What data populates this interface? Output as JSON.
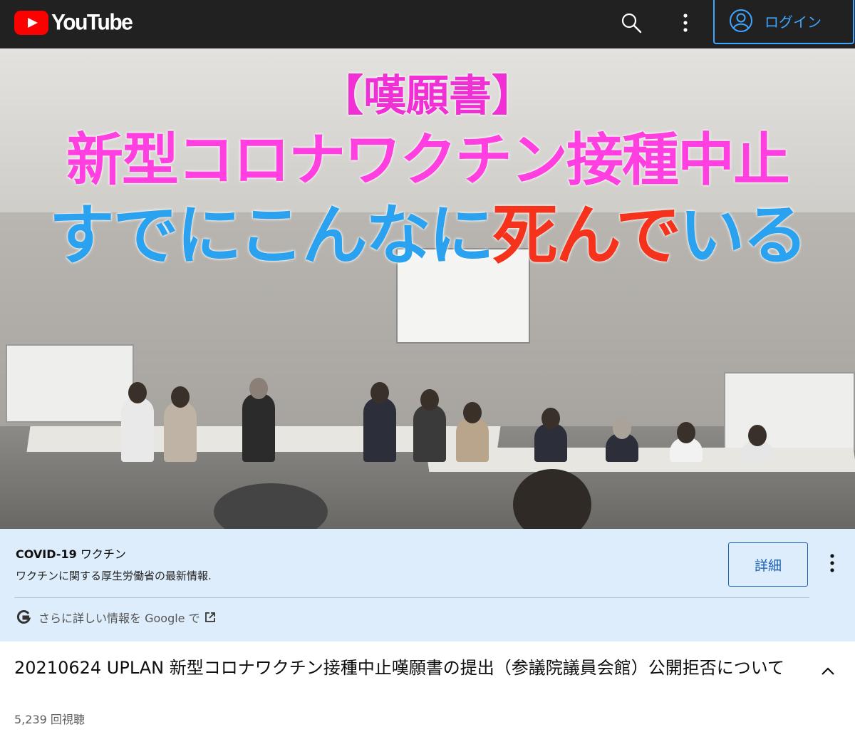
{
  "header": {
    "logo_text": "YouTube",
    "login_label": "ログイン",
    "icons": {
      "search": "search-icon",
      "menu": "more-vert-icon",
      "account": "account-circle-icon"
    },
    "colors": {
      "bar": "#212121",
      "brand": "#ff0000",
      "accent": "#3ea6ff"
    }
  },
  "video": {
    "thumbnail_text": {
      "line1": "【嘆願書】",
      "line2": "新型コロナワクチン接種中止",
      "line3_part1": "すでにこんなに",
      "line3_part2": "死んで",
      "line3_part3": "いる"
    },
    "colors": {
      "magenta": "#ff3fe0",
      "blue": "#2aa2f0",
      "red": "#f5331d"
    }
  },
  "info_panel": {
    "title_bold": "COVID-19",
    "title_rest": " ワクチン",
    "subtitle": "ワクチンに関する厚生労働省の最新情報.",
    "detail_button": "詳細",
    "google_text": "さらに詳しい情報を Google で",
    "icons": {
      "google": "google-g-icon",
      "external": "external-link-icon",
      "menu": "more-vert-icon"
    },
    "colors": {
      "background": "#deedfb",
      "button": "#1a5fb4"
    }
  },
  "details": {
    "title": "20210624 UPLAN 新型コロナワクチン接種中止嘆願書の提出（参議院議員会館）公開拒否について",
    "views": "5,239 回視聴"
  }
}
